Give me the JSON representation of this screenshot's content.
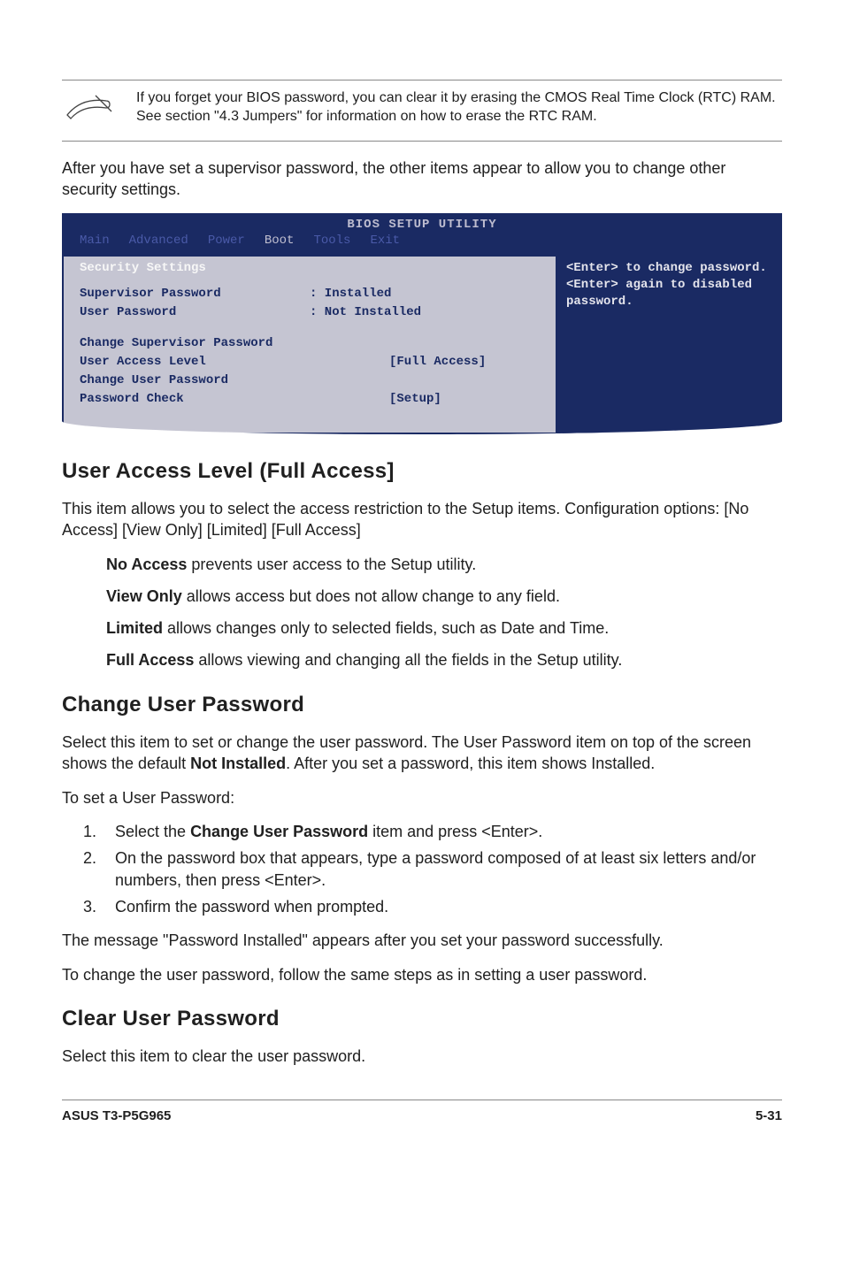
{
  "note": {
    "text": "If you forget your BIOS password, you can clear it by erasing the CMOS Real Time Clock (RTC) RAM. See section \"4.3 Jumpers\" for information on how to erase the RTC RAM."
  },
  "intro": "After you have set a supervisor password, the other items appear to allow you to change other security settings.",
  "bios": {
    "title": "BIOS SETUP UTILITY",
    "menu": [
      "Main",
      "Advanced",
      "Power",
      "Boot",
      "Tools",
      "Exit"
    ],
    "section": "Security Settings",
    "rows": {
      "supervisor_label": "Supervisor Password",
      "supervisor_value": ": Installed",
      "user_label": "User Password",
      "user_value": ": Not Installed",
      "change_super": "Change Supervisor Password",
      "ual_label": "User Access Level",
      "ual_value": "[Full Access]",
      "change_user": "Change User Password",
      "pwcheck_label": "Password Check",
      "pwcheck_value": "[Setup]"
    },
    "help": "<Enter> to change password.\n<Enter> again to disabled password."
  },
  "ual": {
    "heading": "User Access Level (Full Access]",
    "desc": "This item allows you to select the access restriction to the Setup items. Configuration options: [No Access] [View Only] [Limited] [Full Access]",
    "no_access_label": "No Access",
    "no_access_text": " prevents user access to the Setup utility.",
    "view_only_label": "View Only",
    "view_only_text": " allows access but does not allow change to any field.",
    "limited_label": "Limited",
    "limited_text": " allows changes only to selected fields, such as Date and Time.",
    "full_access_label": "Full Access",
    "full_access_text": " allows viewing and changing all the fields in the Setup utility."
  },
  "cup": {
    "heading": "Change User Password",
    "p1a": "Select this item to set or change the user password. The User Password item on top of the screen shows the default ",
    "p1b": "Not Installed",
    "p1c": ". After you set a password, this item shows Installed.",
    "p2": "To set a User Password:",
    "li1a": "Select the ",
    "li1b": "Change User Password",
    "li1c": " item and press <Enter>.",
    "li2": "On the password box that appears, type a password composed of at least six letters and/or numbers, then press <Enter>.",
    "li3": "Confirm the password when prompted.",
    "p3": "The message \"Password Installed\" appears after you set your password successfully.",
    "p4": "To change the user password, follow the same steps as in setting a user password."
  },
  "clr": {
    "heading": "Clear User Password",
    "p1": "Select this item to clear the user password."
  },
  "footer": {
    "left": "ASUS T3-P5G965",
    "right": "5-31"
  }
}
